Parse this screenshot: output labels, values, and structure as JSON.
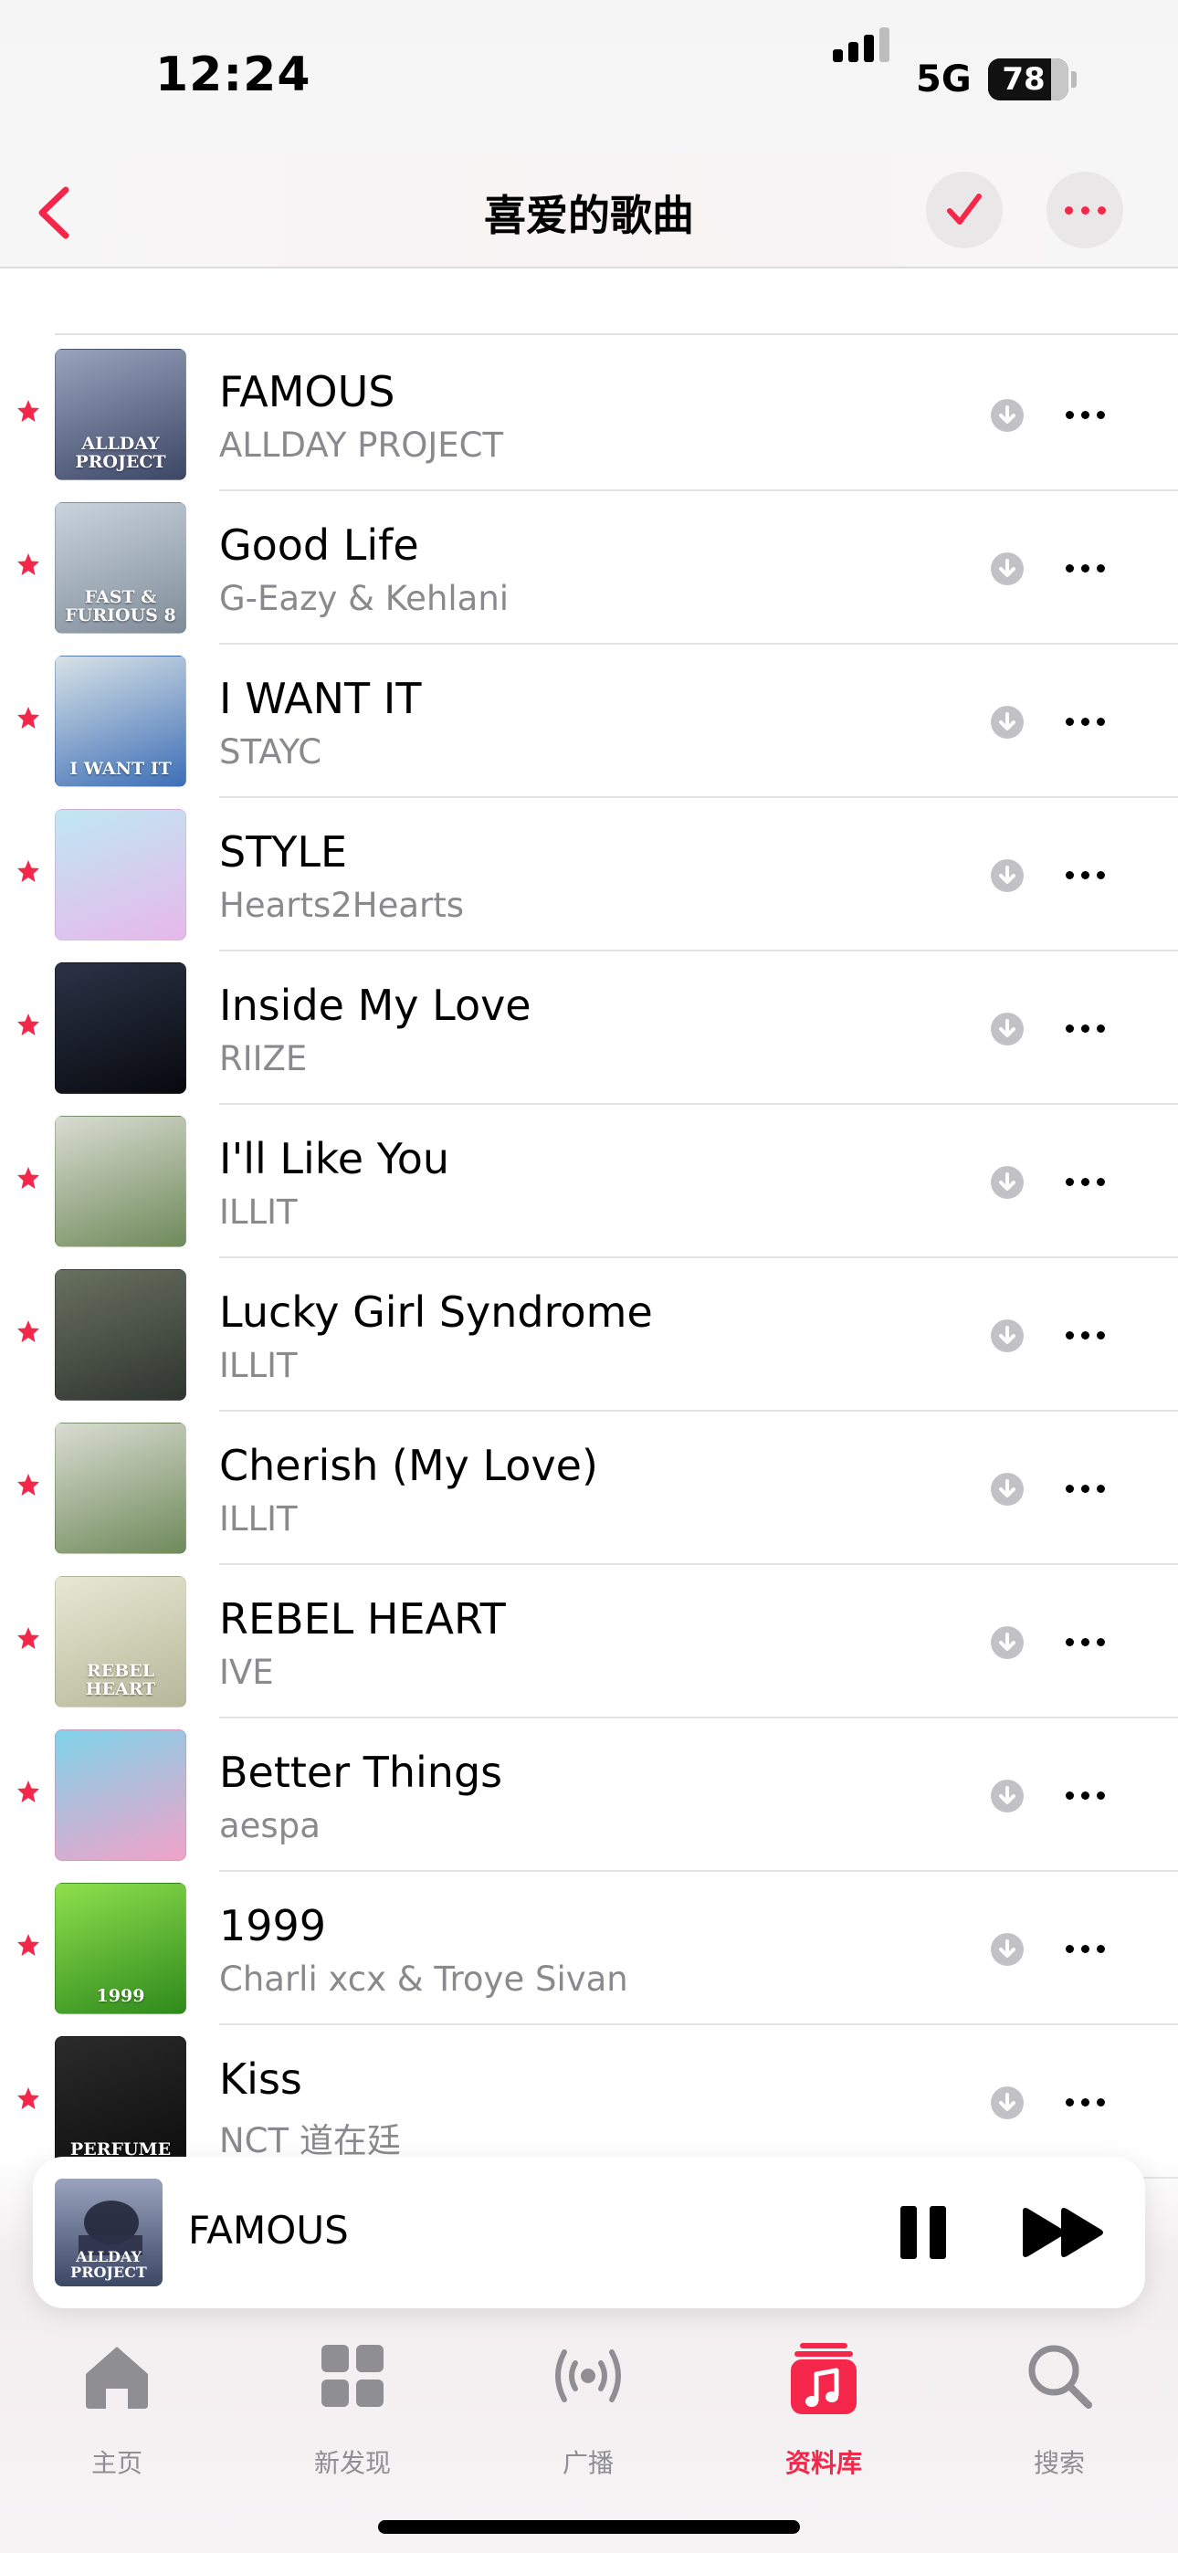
{
  "status_bar": {
    "time": "12:24",
    "network": "5G",
    "battery": "78",
    "battery_level": 0.78
  },
  "navbar": {
    "title": "喜爱的歌曲",
    "back_icon": "chevron-left-icon",
    "select_icon": "checkmark-icon",
    "more_icon": "ellipsis-icon"
  },
  "colors": {
    "accent": "#f4274a",
    "secondary_text": "#8a8a8e",
    "separator": "#e2e2e2"
  },
  "songs": [
    {
      "title": "FAMOUS",
      "artist": "ALLDAY PROJECT",
      "favorite": true,
      "cover_text": "ALLDAY PROJECT",
      "cover_colors": [
        "#9aa3bd",
        "#3c4766"
      ]
    },
    {
      "title": "Good Life",
      "artist": "G-Eazy & Kehlani",
      "favorite": true,
      "cover_text": "FAST & FURIOUS 8",
      "cover_colors": [
        "#c9d3dc",
        "#7f8c99"
      ]
    },
    {
      "title": "I WANT IT",
      "artist": "STAYC",
      "favorite": true,
      "cover_text": "I WANT IT",
      "cover_colors": [
        "#d8e2e6",
        "#3d6fb7"
      ]
    },
    {
      "title": "STYLE",
      "artist": "Hearts2Hearts",
      "favorite": true,
      "cover_text": "",
      "cover_colors": [
        "#bfe8f3",
        "#e7b8ea"
      ]
    },
    {
      "title": "Inside My Love",
      "artist": "RIIZE",
      "favorite": true,
      "cover_text": "",
      "cover_colors": [
        "#2a3346",
        "#08090e"
      ]
    },
    {
      "title": "I'll Like You",
      "artist": "ILLIT",
      "favorite": true,
      "cover_text": "",
      "cover_colors": [
        "#d9dcd2",
        "#6f8a5a"
      ]
    },
    {
      "title": "Lucky Girl Syndrome",
      "artist": "ILLIT",
      "favorite": true,
      "cover_text": "",
      "cover_colors": [
        "#68705f",
        "#2f3530"
      ]
    },
    {
      "title": "Cherish (My Love)",
      "artist": "ILLIT",
      "favorite": true,
      "cover_text": "",
      "cover_colors": [
        "#d9dcd2",
        "#6f8a5a"
      ]
    },
    {
      "title": "REBEL HEART",
      "artist": "IVE",
      "favorite": true,
      "cover_text": "REBEL HEART",
      "cover_colors": [
        "#e7e8d3",
        "#b6b89a"
      ]
    },
    {
      "title": "Better Things",
      "artist": "aespa",
      "favorite": true,
      "cover_text": "",
      "cover_colors": [
        "#7fd3ea",
        "#f1a2c8"
      ]
    },
    {
      "title": "1999",
      "artist": "Charli xcx & Troye Sivan",
      "favorite": true,
      "cover_text": "1999",
      "cover_colors": [
        "#8ee04c",
        "#2f8a1c"
      ]
    },
    {
      "title": "Kiss",
      "artist": "NCT 道在廷",
      "favorite": true,
      "cover_text": "PERFUME",
      "cover_colors": [
        "#2b2b2b",
        "#0d0d0d"
      ]
    }
  ],
  "now_playing": {
    "title": "FAMOUS",
    "cover_text": "ALLDAY PROJECT",
    "pause_icon": "pause-icon",
    "next_icon": "fast-forward-icon"
  },
  "tabs": [
    {
      "label": "主页",
      "icon": "home-icon",
      "active": false
    },
    {
      "label": "新发现",
      "icon": "grid-icon",
      "active": false
    },
    {
      "label": "广播",
      "icon": "radio-icon",
      "active": false
    },
    {
      "label": "资料库",
      "icon": "music-library-icon",
      "active": true
    },
    {
      "label": "搜索",
      "icon": "search-icon",
      "active": false
    }
  ]
}
